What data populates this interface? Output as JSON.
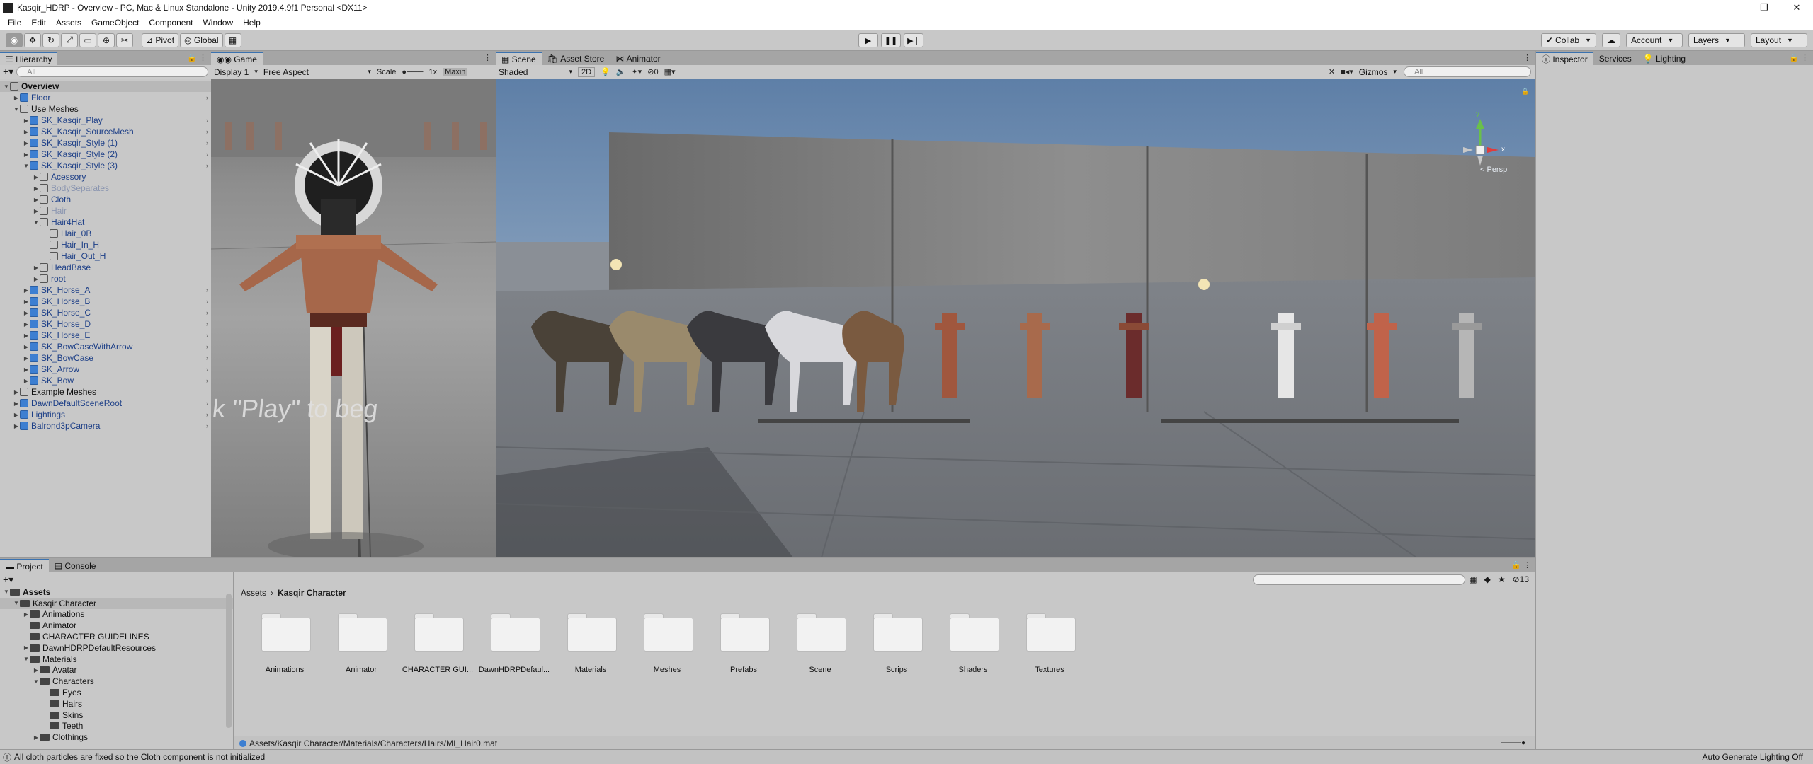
{
  "window": {
    "title": "Kasqir_HDRP - Overview - PC, Mac & Linux Standalone - Unity 2019.4.9f1 Personal <DX11>",
    "minimize": "—",
    "maximize": "❐",
    "close": "✕"
  },
  "menu": [
    "File",
    "Edit",
    "Assets",
    "GameObject",
    "Component",
    "Window",
    "Help"
  ],
  "toolbar": {
    "pivot": "Pivot",
    "global": "Global",
    "collab": "Collab",
    "account": "Account",
    "layers": "Layers",
    "layout": "Layout"
  },
  "hierarchy": {
    "tab": "Hierarchy",
    "search_placeholder": "All",
    "rows": [
      {
        "label": "Overview",
        "depth": 0,
        "arrow": "▼",
        "type": "scene",
        "style": "plain"
      },
      {
        "label": "Floor",
        "depth": 1,
        "arrow": "▶",
        "type": "prefab",
        "style": "blue"
      },
      {
        "label": "Use Meshes",
        "depth": 1,
        "arrow": "▼",
        "type": "go",
        "style": "plain"
      },
      {
        "label": "SK_Kasqir_Play",
        "depth": 2,
        "arrow": "▶",
        "type": "prefab",
        "style": "blue"
      },
      {
        "label": "SK_Kasqir_SourceMesh",
        "depth": 2,
        "arrow": "▶",
        "type": "prefab",
        "style": "blue"
      },
      {
        "label": "SK_Kasqir_Style (1)",
        "depth": 2,
        "arrow": "▶",
        "type": "prefab",
        "style": "blue"
      },
      {
        "label": "SK_Kasqir_Style (2)",
        "depth": 2,
        "arrow": "▶",
        "type": "prefab",
        "style": "blue"
      },
      {
        "label": "SK_Kasqir_Style (3)",
        "depth": 2,
        "arrow": "▼",
        "type": "prefab",
        "style": "blue"
      },
      {
        "label": "Acessory",
        "depth": 3,
        "arrow": "▶",
        "type": "go",
        "style": "blue"
      },
      {
        "label": "BodySeparates",
        "depth": 3,
        "arrow": "▶",
        "type": "go",
        "style": "dim"
      },
      {
        "label": "Cloth",
        "depth": 3,
        "arrow": "▶",
        "type": "go",
        "style": "blue"
      },
      {
        "label": "Hair",
        "depth": 3,
        "arrow": "▶",
        "type": "go",
        "style": "dim"
      },
      {
        "label": "Hair4Hat",
        "depth": 3,
        "arrow": "▼",
        "type": "go",
        "style": "blue"
      },
      {
        "label": "Hair_0B",
        "depth": 4,
        "arrow": "",
        "type": "go",
        "style": "blue"
      },
      {
        "label": "Hair_In_H",
        "depth": 4,
        "arrow": "",
        "type": "go",
        "style": "blue"
      },
      {
        "label": "Hair_Out_H",
        "depth": 4,
        "arrow": "",
        "type": "go",
        "style": "blue"
      },
      {
        "label": "HeadBase",
        "depth": 3,
        "arrow": "▶",
        "type": "go",
        "style": "blue"
      },
      {
        "label": "root",
        "depth": 3,
        "arrow": "▶",
        "type": "go",
        "style": "blue"
      },
      {
        "label": "SK_Horse_A",
        "depth": 2,
        "arrow": "▶",
        "type": "prefab",
        "style": "blue"
      },
      {
        "label": "SK_Horse_B",
        "depth": 2,
        "arrow": "▶",
        "type": "prefab",
        "style": "blue"
      },
      {
        "label": "SK_Horse_C",
        "depth": 2,
        "arrow": "▶",
        "type": "prefab",
        "style": "blue"
      },
      {
        "label": "SK_Horse_D",
        "depth": 2,
        "arrow": "▶",
        "type": "prefab",
        "style": "blue"
      },
      {
        "label": "SK_Horse_E",
        "depth": 2,
        "arrow": "▶",
        "type": "prefab",
        "style": "blue"
      },
      {
        "label": "SK_BowCaseWithArrow",
        "depth": 2,
        "arrow": "▶",
        "type": "prefab",
        "style": "blue"
      },
      {
        "label": "SK_BowCase",
        "depth": 2,
        "arrow": "▶",
        "type": "prefab",
        "style": "blue"
      },
      {
        "label": "SK_Arrow",
        "depth": 2,
        "arrow": "▶",
        "type": "prefab",
        "style": "blue"
      },
      {
        "label": "SK_Bow",
        "depth": 2,
        "arrow": "▶",
        "type": "prefab",
        "style": "blue"
      },
      {
        "label": "Example Meshes",
        "depth": 1,
        "arrow": "▶",
        "type": "go",
        "style": "plain"
      },
      {
        "label": "DawnDefaultSceneRoot",
        "depth": 1,
        "arrow": "▶",
        "type": "prefab",
        "style": "blue"
      },
      {
        "label": "Lightings",
        "depth": 1,
        "arrow": "▶",
        "type": "prefab",
        "style": "blue"
      },
      {
        "label": "Balrond3pCamera",
        "depth": 1,
        "arrow": "▶",
        "type": "prefab",
        "style": "blue"
      }
    ]
  },
  "game": {
    "tab": "Game",
    "display": "Display 1",
    "aspect": "Free Aspect",
    "scale_label": "Scale",
    "scale_value": "1x",
    "maximize": "Maxin",
    "overlay_text": "k \"Play\" to beg"
  },
  "scene": {
    "tabs": [
      "Scene",
      "Asset Store",
      "Animator"
    ],
    "shading": "Shaded",
    "mode_2d": "2D",
    "hidden_count": "0",
    "gizmos": "Gizmos",
    "search_placeholder": "All",
    "persp": "< Persp",
    "axis_y": "y",
    "axis_x": "x"
  },
  "right_panel": {
    "tabs": [
      "Inspector",
      "Services",
      "Lighting"
    ]
  },
  "project": {
    "tabs": [
      "Project",
      "Console"
    ],
    "layers_count": "13",
    "tree": [
      {
        "label": "Assets",
        "depth": 0,
        "arrow": "▼",
        "bold": true
      },
      {
        "label": "Kasqir Character",
        "depth": 1,
        "arrow": "▼",
        "sel": true
      },
      {
        "label": "Animations",
        "depth": 2,
        "arrow": "▶"
      },
      {
        "label": "Animator",
        "depth": 2,
        "arrow": ""
      },
      {
        "label": "CHARACTER GUIDELINES",
        "depth": 2,
        "arrow": ""
      },
      {
        "label": "DawnHDRPDefaultResources",
        "depth": 2,
        "arrow": "▶"
      },
      {
        "label": "Materials",
        "depth": 2,
        "arrow": "▼"
      },
      {
        "label": "Avatar",
        "depth": 3,
        "arrow": "▶"
      },
      {
        "label": "Characters",
        "depth": 3,
        "arrow": "▼"
      },
      {
        "label": "Eyes",
        "depth": 4,
        "arrow": ""
      },
      {
        "label": "Hairs",
        "depth": 4,
        "arrow": ""
      },
      {
        "label": "Skins",
        "depth": 4,
        "arrow": ""
      },
      {
        "label": "Teeth",
        "depth": 4,
        "arrow": ""
      },
      {
        "label": "Clothings",
        "depth": 3,
        "arrow": "▶"
      }
    ],
    "breadcrumb": [
      "Assets",
      "Kasqir Character"
    ],
    "folders": [
      "Animations",
      "Animator",
      "CHARACTER GUI...",
      "DawnHDRPDefaul...",
      "Materials",
      "Meshes",
      "Prefabs",
      "Scene",
      "Scrips",
      "Shaders",
      "Textures"
    ],
    "selected_path": "Assets/Kasqir Character/Materials/Characters/Hairs/MI_Hair0.mat"
  },
  "status": {
    "message": "All cloth particles are fixed so the Cloth component is not initialized",
    "right": "Auto Generate Lighting Off"
  }
}
